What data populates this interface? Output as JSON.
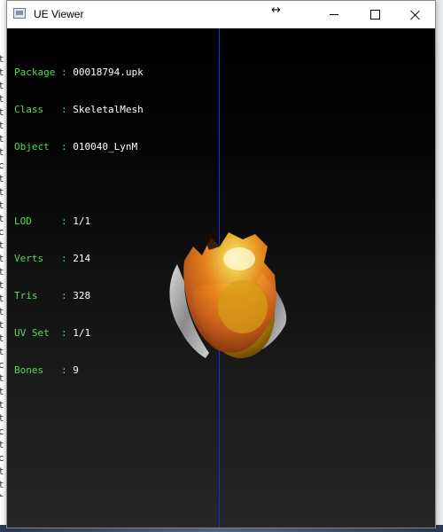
{
  "window": {
    "title": "UE Viewer"
  },
  "titlebar": {
    "resize_cursor_icon": "horizontal-resize-cursor"
  },
  "info": {
    "rows": [
      {
        "label": "Package",
        "value": "00018794.upk"
      },
      {
        "label": "Class",
        "value": "SkeletalMesh"
      },
      {
        "label": "Object",
        "value": "010040_LynM"
      },
      {
        "label": "LOD",
        "value": "1/1"
      },
      {
        "label": "Verts",
        "value": "214"
      },
      {
        "label": "Tris",
        "value": "328"
      },
      {
        "label": "UV Set",
        "value": "1/1"
      },
      {
        "label": "Bones",
        "value": "9"
      }
    ],
    "separator": " : "
  },
  "colors": {
    "label": "#4fde4f",
    "value": "#ffffff",
    "axis": "#1d2bd8",
    "viewport_top": "#000000",
    "viewport_bottom": "#262626"
  },
  "background_window": {
    "visible_chars": [
      "t",
      "t",
      "t",
      "t",
      "t",
      "t",
      "t",
      "t",
      "c",
      "t",
      "t",
      "t",
      "t",
      "c",
      "t",
      "t",
      "t",
      "t",
      "t",
      "t",
      "t",
      "t",
      "t",
      "c",
      "t",
      "t",
      "t",
      "t",
      "c",
      "t",
      "c",
      "t",
      "t",
      "t",
      "t"
    ]
  }
}
